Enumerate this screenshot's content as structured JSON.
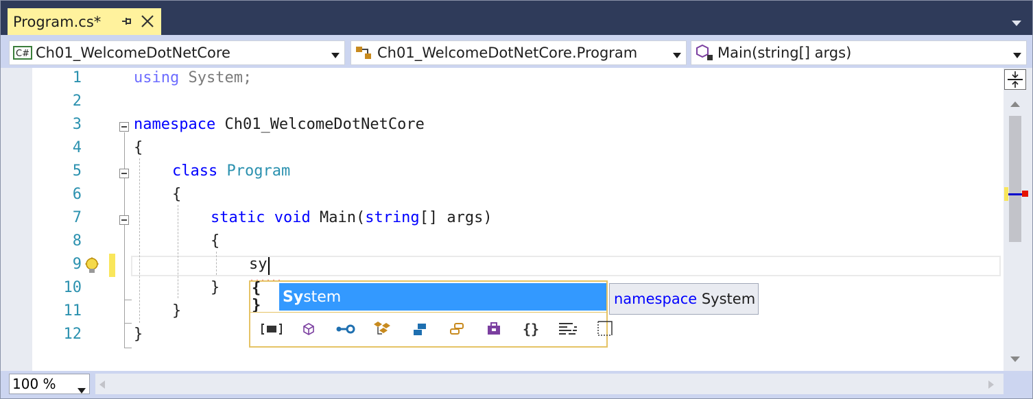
{
  "tab": {
    "title": "Program.cs*",
    "pin_icon": "pin-icon",
    "close_icon": "close-icon"
  },
  "navbar": {
    "project": "Ch01_WelcomeDotNetCore",
    "project_icon": "csharp-project-icon",
    "type": "Ch01_WelcomeDotNetCore.Program",
    "type_icon": "class-icon",
    "member": "Main(string[] args)",
    "member_icon": "method-private-icon"
  },
  "line_numbers": [
    "1",
    "2",
    "3",
    "4",
    "5",
    "6",
    "7",
    "8",
    "9",
    "10",
    "11",
    "12"
  ],
  "code": {
    "l1_kw": "using",
    "l1_rest": " System;",
    "l3_kw": "namespace",
    "l3_rest": " Ch01_WelcomeDotNetCore",
    "l4": "{",
    "l5_kw": "class",
    "l5_type": "Program",
    "l6": "{",
    "l7_kw1": "static",
    "l7_kw2": "void",
    "l7_name": " Main(",
    "l7_kw3": "string",
    "l7_rest": "[] args)",
    "l8": "{",
    "l9": "sy",
    "l10": "}",
    "l11": "}",
    "l12": "}"
  },
  "completion": {
    "item_icon_text": "{ }",
    "item_match": "Sy",
    "item_rest": "stem",
    "filter_icons": [
      "namespace-filter-icon",
      "class-filter-icon",
      "interface-filter-icon",
      "struct-filter-icon",
      "enum-filter-icon",
      "delegate-filter-icon",
      "module-filter-icon",
      "namespace-braces-filter-icon",
      "snippet-filter-icon",
      "keyword-filter-icon"
    ]
  },
  "tooltip": {
    "keyword": "namespace",
    "name": " System"
  },
  "zoom": {
    "value": "100 %"
  },
  "colors": {
    "keyword": "#0000ff",
    "type": "#2b91af",
    "selection": "#3399ff",
    "tab_active": "#fff29d",
    "chrome": "#ccd5f0"
  }
}
